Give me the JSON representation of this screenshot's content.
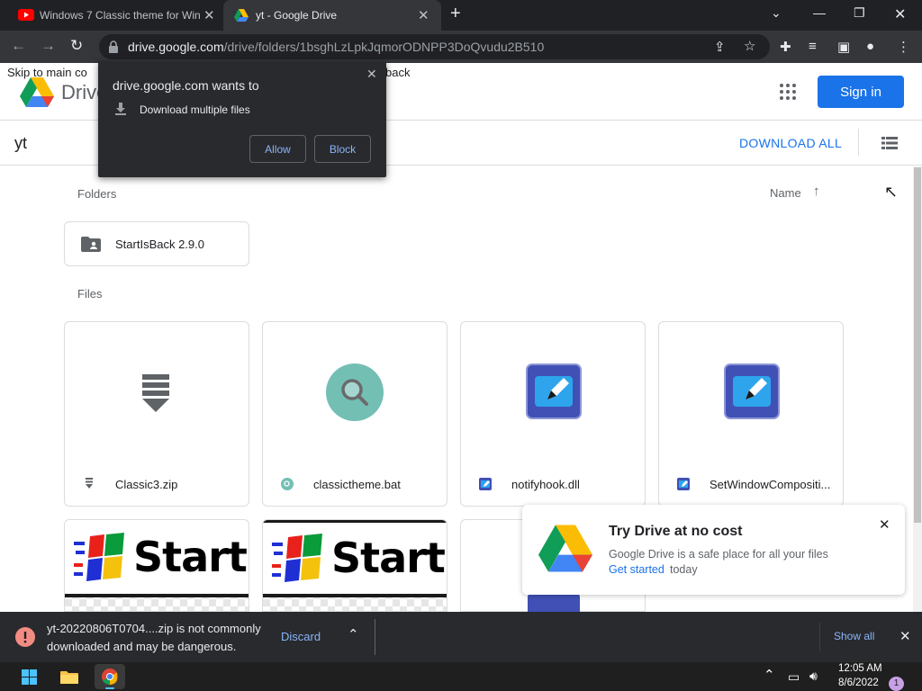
{
  "tabs": [
    {
      "title": "Windows 7 Classic theme for Win",
      "active": false,
      "favicon": "youtube-icon"
    },
    {
      "title": "yt - Google Drive",
      "active": true,
      "favicon": "drive-icon"
    }
  ],
  "toolbar": {
    "url_domain": "drive.google.com",
    "url_path": "/drive/folders/1bsghLzLpkJqmorODNPP3DoQvudu2B510"
  },
  "page": {
    "skip_link": "Skip to main co",
    "skip_link_tail": "back",
    "logo_text": "Drive",
    "signin_label": "Sign in",
    "folder_title": "yt",
    "download_all": "DOWNLOAD ALL",
    "folders_heading": "Folders",
    "sort_label": "Name",
    "folders": [
      {
        "name": "StartIsBack 2.9.0"
      }
    ],
    "files_heading": "Files",
    "files": [
      {
        "name": "Classic3.zip",
        "kind": "zip"
      },
      {
        "name": "classictheme.bat",
        "kind": "bat"
      },
      {
        "name": "notifyhook.dll",
        "kind": "dll"
      },
      {
        "name": "SetWindowCompositi...",
        "kind": "dll"
      }
    ],
    "thumb_text": "Start"
  },
  "permission_popup": {
    "title": "drive.google.com wants to",
    "item": "Download multiple files",
    "allow": "Allow",
    "block": "Block"
  },
  "toast": {
    "title": "Try Drive at no cost",
    "body": "Google Drive is a safe place for all your files",
    "link": "Get started",
    "tail": "today"
  },
  "download_bar": {
    "line1": "yt-20220806T0704....zip is not commonly",
    "line2": "downloaded and may be dangerous.",
    "discard": "Discard",
    "show_all": "Show all"
  },
  "taskbar": {
    "time": "12:05 AM",
    "date": "8/6/2022",
    "badge": "1"
  },
  "colors": {
    "accent": "#1a73e8",
    "warning": "#f28b82",
    "link_dark": "#8ab4f8"
  }
}
